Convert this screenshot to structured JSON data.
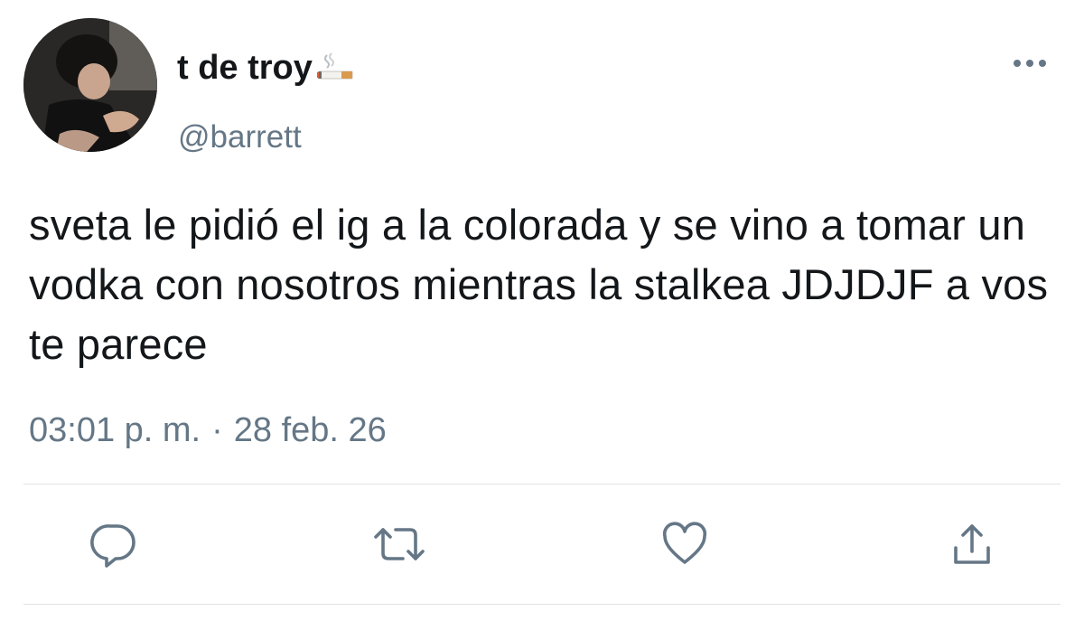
{
  "tweet": {
    "display_name": "t de troy",
    "name_emoji_icon": "cigarette-icon",
    "handle": "@barrett",
    "text": "sveta le pidió el ig a la colorada y se vino a tomar un vodka con nosotros mientras la stalkea JDJDJF a vos te parece",
    "time": "03:01 p. m.",
    "separator": "·",
    "date": "28 feb. 26"
  },
  "actions": {
    "reply_icon": "reply-icon",
    "retweet_icon": "retweet-icon",
    "like_icon": "heart-icon",
    "share_icon": "share-icon",
    "more_icon": "more-options-icon"
  },
  "colors": {
    "text": "#14171a",
    "secondary": "#657786",
    "icon": "#657786",
    "divider": "#dfe3e6",
    "background": "#ffffff"
  }
}
